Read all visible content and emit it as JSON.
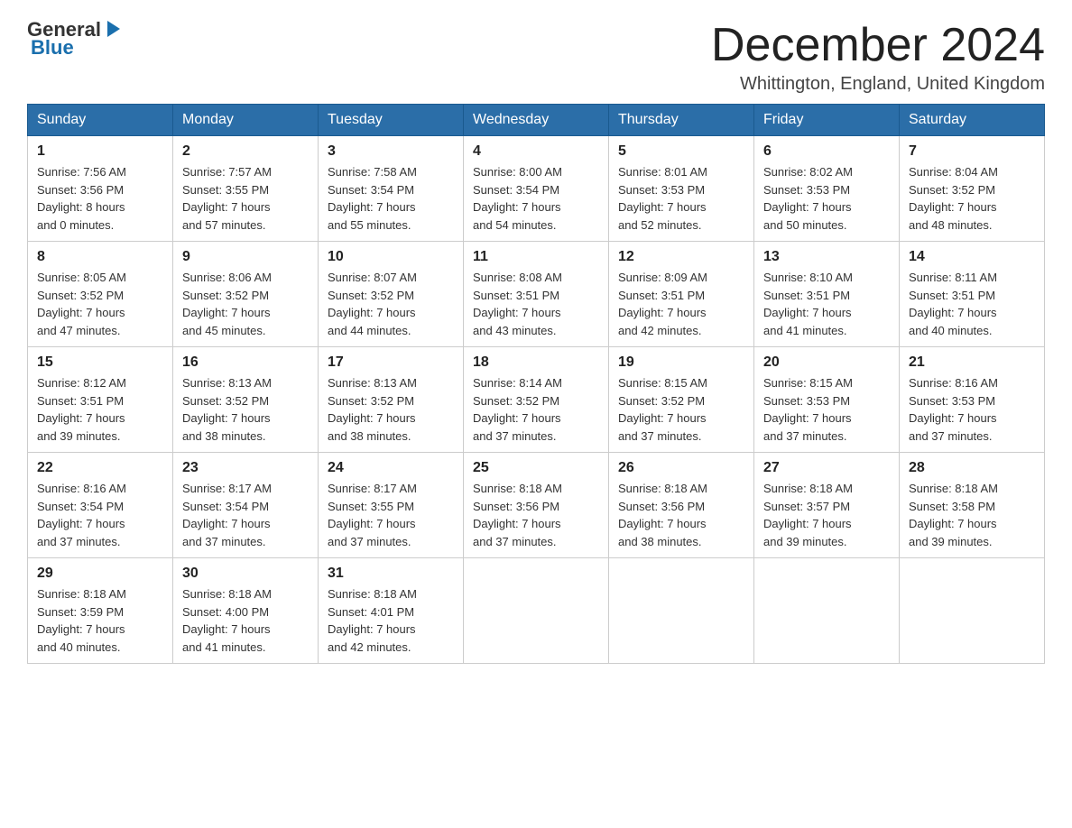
{
  "header": {
    "logo": {
      "general": "General",
      "blue": "Blue",
      "arrow": "▶"
    },
    "title": "December 2024",
    "location": "Whittington, England, United Kingdom"
  },
  "weekdays": [
    "Sunday",
    "Monday",
    "Tuesday",
    "Wednesday",
    "Thursday",
    "Friday",
    "Saturday"
  ],
  "weeks": [
    [
      {
        "day": "1",
        "sunrise": "7:56 AM",
        "sunset": "3:56 PM",
        "daylight": "8 hours and 0 minutes."
      },
      {
        "day": "2",
        "sunrise": "7:57 AM",
        "sunset": "3:55 PM",
        "daylight": "7 hours and 57 minutes."
      },
      {
        "day": "3",
        "sunrise": "7:58 AM",
        "sunset": "3:54 PM",
        "daylight": "7 hours and 55 minutes."
      },
      {
        "day": "4",
        "sunrise": "8:00 AM",
        "sunset": "3:54 PM",
        "daylight": "7 hours and 54 minutes."
      },
      {
        "day": "5",
        "sunrise": "8:01 AM",
        "sunset": "3:53 PM",
        "daylight": "7 hours and 52 minutes."
      },
      {
        "day": "6",
        "sunrise": "8:02 AM",
        "sunset": "3:53 PM",
        "daylight": "7 hours and 50 minutes."
      },
      {
        "day": "7",
        "sunrise": "8:04 AM",
        "sunset": "3:52 PM",
        "daylight": "7 hours and 48 minutes."
      }
    ],
    [
      {
        "day": "8",
        "sunrise": "8:05 AM",
        "sunset": "3:52 PM",
        "daylight": "7 hours and 47 minutes."
      },
      {
        "day": "9",
        "sunrise": "8:06 AM",
        "sunset": "3:52 PM",
        "daylight": "7 hours and 45 minutes."
      },
      {
        "day": "10",
        "sunrise": "8:07 AM",
        "sunset": "3:52 PM",
        "daylight": "7 hours and 44 minutes."
      },
      {
        "day": "11",
        "sunrise": "8:08 AM",
        "sunset": "3:51 PM",
        "daylight": "7 hours and 43 minutes."
      },
      {
        "day": "12",
        "sunrise": "8:09 AM",
        "sunset": "3:51 PM",
        "daylight": "7 hours and 42 minutes."
      },
      {
        "day": "13",
        "sunrise": "8:10 AM",
        "sunset": "3:51 PM",
        "daylight": "7 hours and 41 minutes."
      },
      {
        "day": "14",
        "sunrise": "8:11 AM",
        "sunset": "3:51 PM",
        "daylight": "7 hours and 40 minutes."
      }
    ],
    [
      {
        "day": "15",
        "sunrise": "8:12 AM",
        "sunset": "3:51 PM",
        "daylight": "7 hours and 39 minutes."
      },
      {
        "day": "16",
        "sunrise": "8:13 AM",
        "sunset": "3:52 PM",
        "daylight": "7 hours and 38 minutes."
      },
      {
        "day": "17",
        "sunrise": "8:13 AM",
        "sunset": "3:52 PM",
        "daylight": "7 hours and 38 minutes."
      },
      {
        "day": "18",
        "sunrise": "8:14 AM",
        "sunset": "3:52 PM",
        "daylight": "7 hours and 37 minutes."
      },
      {
        "day": "19",
        "sunrise": "8:15 AM",
        "sunset": "3:52 PM",
        "daylight": "7 hours and 37 minutes."
      },
      {
        "day": "20",
        "sunrise": "8:15 AM",
        "sunset": "3:53 PM",
        "daylight": "7 hours and 37 minutes."
      },
      {
        "day": "21",
        "sunrise": "8:16 AM",
        "sunset": "3:53 PM",
        "daylight": "7 hours and 37 minutes."
      }
    ],
    [
      {
        "day": "22",
        "sunrise": "8:16 AM",
        "sunset": "3:54 PM",
        "daylight": "7 hours and 37 minutes."
      },
      {
        "day": "23",
        "sunrise": "8:17 AM",
        "sunset": "3:54 PM",
        "daylight": "7 hours and 37 minutes."
      },
      {
        "day": "24",
        "sunrise": "8:17 AM",
        "sunset": "3:55 PM",
        "daylight": "7 hours and 37 minutes."
      },
      {
        "day": "25",
        "sunrise": "8:18 AM",
        "sunset": "3:56 PM",
        "daylight": "7 hours and 37 minutes."
      },
      {
        "day": "26",
        "sunrise": "8:18 AM",
        "sunset": "3:56 PM",
        "daylight": "7 hours and 38 minutes."
      },
      {
        "day": "27",
        "sunrise": "8:18 AM",
        "sunset": "3:57 PM",
        "daylight": "7 hours and 39 minutes."
      },
      {
        "day": "28",
        "sunrise": "8:18 AM",
        "sunset": "3:58 PM",
        "daylight": "7 hours and 39 minutes."
      }
    ],
    [
      {
        "day": "29",
        "sunrise": "8:18 AM",
        "sunset": "3:59 PM",
        "daylight": "7 hours and 40 minutes."
      },
      {
        "day": "30",
        "sunrise": "8:18 AM",
        "sunset": "4:00 PM",
        "daylight": "7 hours and 41 minutes."
      },
      {
        "day": "31",
        "sunrise": "8:18 AM",
        "sunset": "4:01 PM",
        "daylight": "7 hours and 42 minutes."
      },
      null,
      null,
      null,
      null
    ]
  ]
}
